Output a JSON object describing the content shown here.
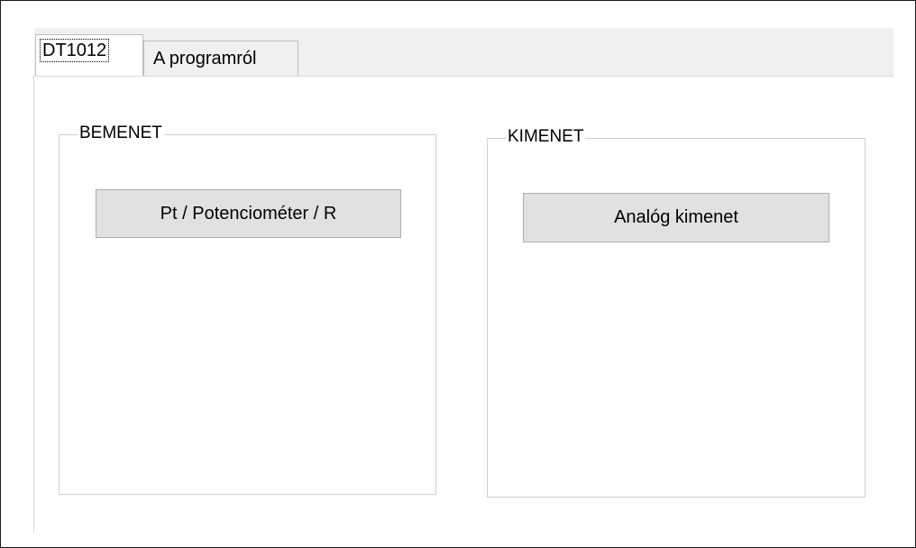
{
  "tabs": [
    {
      "label": "DT1012",
      "active": true
    },
    {
      "label": "A programról",
      "active": false
    }
  ],
  "input_group": {
    "title": "BEMENET",
    "button_label": "Pt / Potenciométer / R"
  },
  "output_group": {
    "title": "KIMENET",
    "button_label": "Analóg kimenet"
  }
}
